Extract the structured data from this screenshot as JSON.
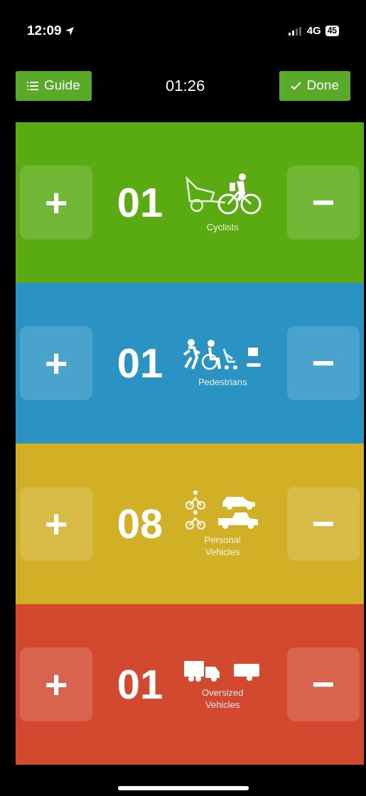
{
  "status_bar": {
    "time": "12:09",
    "network": "4G",
    "battery": "45"
  },
  "header": {
    "guide": "Guide",
    "timer": "01:26",
    "done": "Done"
  },
  "counters": [
    {
      "kind": "cyclists",
      "color": "#5aaa12",
      "count": "01",
      "label": "Cyclists",
      "plus": "+",
      "minus": "−"
    },
    {
      "kind": "pedestrians",
      "color": "#2a93c4",
      "count": "01",
      "label": "Pedestrians",
      "plus": "+",
      "minus": "−"
    },
    {
      "kind": "personal",
      "color": "#d2b026",
      "count": "08",
      "label": "Personal Vehicles",
      "plus": "+",
      "minus": "−"
    },
    {
      "kind": "oversized",
      "color": "#d2492f",
      "count": "01",
      "label": "Oversized Vehicles",
      "plus": "+",
      "minus": "−"
    }
  ]
}
